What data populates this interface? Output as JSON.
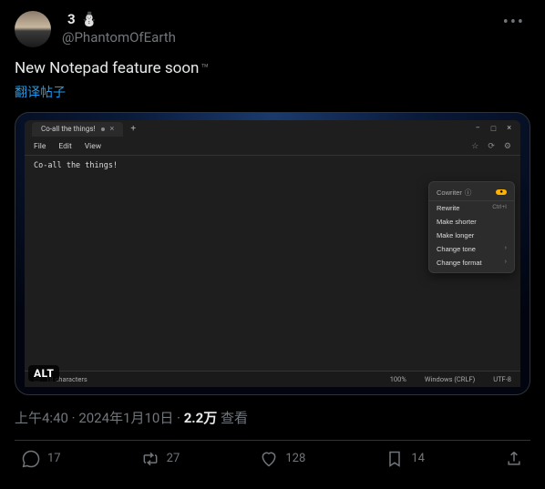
{
  "user": {
    "display_name_partial": "",
    "badge_number": "3",
    "badge_emoji": "⛄",
    "handle": "@PhantomOfEarth"
  },
  "tweet": {
    "text": "New Notepad feature soon",
    "tm": "™",
    "translate_label": "翻译帖子"
  },
  "media": {
    "alt_badge": "ALT",
    "notepad": {
      "tab_title": "Co-all the things!",
      "new_tab": "+",
      "win_min": "−",
      "win_max": "□",
      "win_close": "×",
      "menu_file": "File",
      "menu_edit": "Edit",
      "menu_view": "View",
      "gear": "⚙",
      "editor_text": "Co-all the things!",
      "ctx": {
        "header": "Cowriter",
        "header_icon": "ⓘ",
        "badge": "●",
        "item_rewrite": "Rewrite",
        "shortcut_rewrite": "Ctrl+I",
        "item_shorter": "Make shorter",
        "item_longer": "Make longer",
        "item_tone": "Change tone",
        "item_format": "Change format"
      },
      "status": {
        "chars": "18 characters",
        "zoom": "100%",
        "line_ending": "Windows (CRLF)",
        "encoding": "UTF-8"
      }
    }
  },
  "meta": {
    "time": "上午4:40",
    "dot1": " · ",
    "date": "2024年1月10日",
    "dot2": " · ",
    "views_num": "2.2万",
    "views_label": " 查看"
  },
  "actions": {
    "replies": "17",
    "retweets": "27",
    "likes": "128",
    "bookmarks": "14"
  }
}
